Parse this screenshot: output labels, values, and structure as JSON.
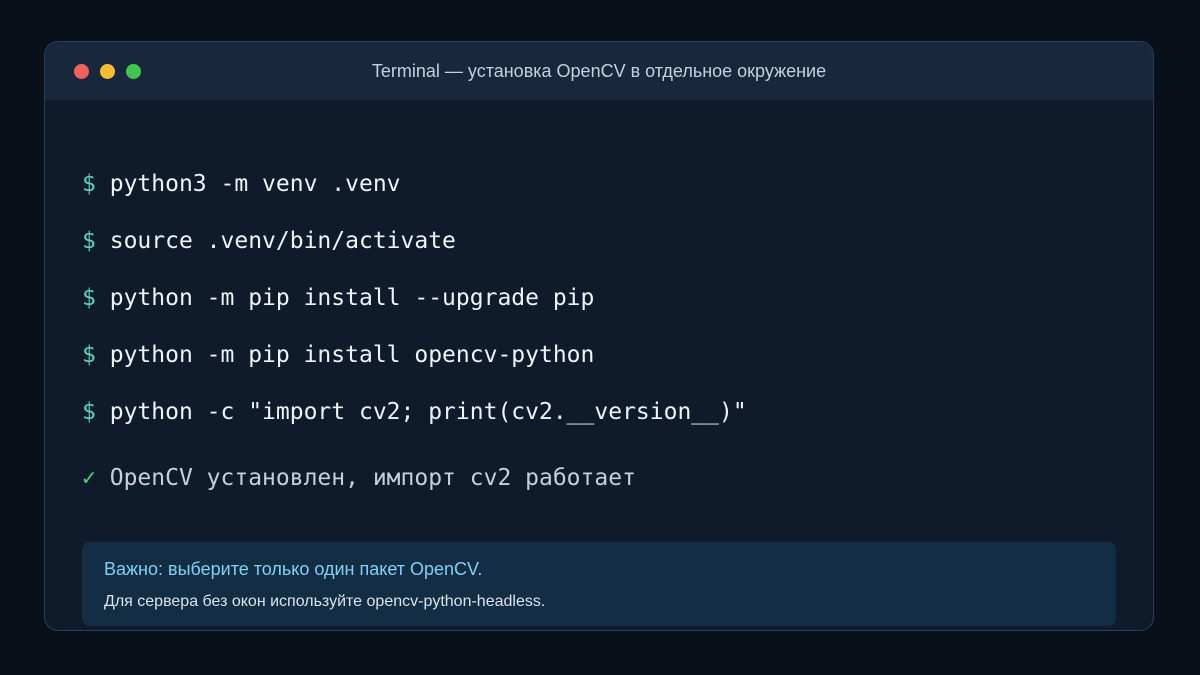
{
  "window": {
    "title": "Terminal — установка OpenCV в отдельное окружение"
  },
  "terminal": {
    "prompt_symbol": "$",
    "commands": [
      "python3 -m venv .venv",
      "source .venv/bin/activate",
      "python -m pip install --upgrade pip",
      "python -m pip install opencv-python",
      "python -c \"import cv2; print(cv2.__version__)\""
    ],
    "result": {
      "icon": "check-icon",
      "symbol": "✓",
      "text": "OpenCV установлен, импорт cv2 работает"
    }
  },
  "note": {
    "title": "Важно: выберите только один пакет OpenCV.",
    "text": "Для сервера без окон используйте opencv-python-headless."
  },
  "colors": {
    "background": "#0a1019",
    "window": "#0f1b2b",
    "titlebar": "#17283c",
    "prompt": "#59d3bd",
    "check": "#4fd16f",
    "note_title": "#7fd2f4",
    "close": "#f2605c",
    "minimize": "#f6bd33",
    "maximize": "#3fc650"
  }
}
